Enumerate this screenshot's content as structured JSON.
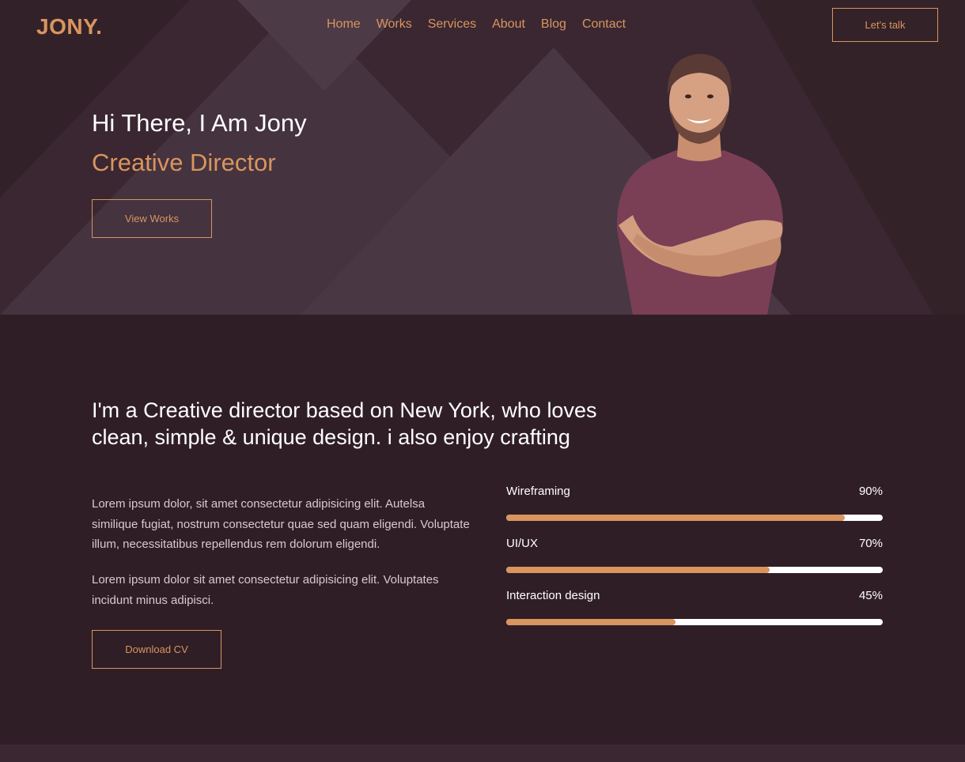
{
  "brand": {
    "logo": "JONY."
  },
  "nav": {
    "items": [
      "Home",
      "Works",
      "Services",
      "About",
      "Blog",
      "Contact"
    ],
    "cta": "Let's talk"
  },
  "hero": {
    "title": "Hi There, I Am Jony",
    "subtitle": "Creative Director",
    "button": "View Works"
  },
  "about": {
    "heading": "I'm a Creative director based on New York, who loves clean, simple & unique design. i also enjoy crafting",
    "paragraph_1": "Lorem ipsum dolor, sit amet consectetur adipisicing elit. Autelsa similique fugiat, nostrum consectetur quae sed quam eligendi. Voluptate illum, necessitatibus repellendus rem dolorum eligendi.",
    "paragraph_2": "Lorem ipsum dolor sit amet consectetur adipisicing elit. Voluptates incidunt minus adipisci.",
    "button": "Download CV"
  },
  "skills": [
    {
      "name": "Wireframing",
      "percent_label": "90%",
      "level": 0.9
    },
    {
      "name": "UI/UX",
      "percent_label": "70%",
      "level": 0.7
    },
    {
      "name": "Interaction design",
      "percent_label": "45%",
      "level": 0.45
    }
  ],
  "colors": {
    "accent": "#d9955e",
    "background": "#301e27",
    "hero_background": "#3a2731",
    "track": "#ffffff"
  }
}
